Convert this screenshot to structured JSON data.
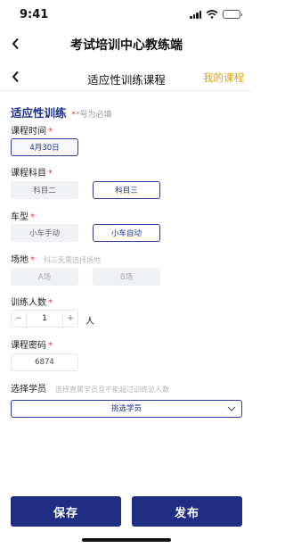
{
  "status": {
    "time": "9:41"
  },
  "app": {
    "title": "考试培训中心教练端"
  },
  "nav": {
    "title": "适应性训练课程",
    "right_link": "我的课程"
  },
  "section": {
    "title": "适应性训练",
    "note": "*号为必填"
  },
  "fields": {
    "course_time": {
      "label": "课程时间",
      "required": "*",
      "value": "4月30日"
    },
    "subject": {
      "label": "课程科目",
      "required": "*",
      "options": [
        "科目二",
        "科目三"
      ],
      "selected": "科目三"
    },
    "car_type": {
      "label": "车型",
      "required": "*",
      "options": [
        "小车手动",
        "小车自动"
      ],
      "selected": "小车自动"
    },
    "venue": {
      "label": "场地",
      "required": "*",
      "hint": "科三无需选择场地",
      "options": [
        "A场",
        "B场"
      ]
    },
    "trainees": {
      "label": "训练人数",
      "required": "*",
      "minus": "−",
      "plus": "+",
      "value": "1",
      "unit": "人"
    },
    "password": {
      "label": "课程密码",
      "required": "*",
      "value": "6874"
    },
    "students": {
      "label": "选择学员",
      "hint": "选择直属学员且不能超过训练总人数",
      "select_label": "挑选学员"
    }
  },
  "actions": {
    "save": "保存",
    "publish": "发布"
  },
  "colors": {
    "primary": "#1f2e82",
    "accent": "#e0a21c",
    "required": "#e23a3a"
  }
}
